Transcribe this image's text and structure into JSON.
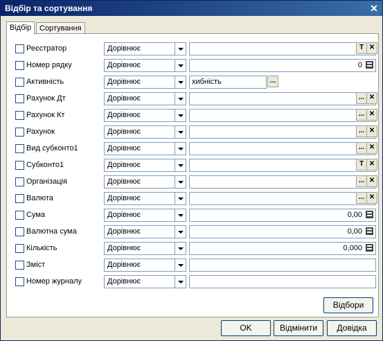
{
  "window": {
    "title": "Відбір та сортування"
  },
  "tabs": [
    {
      "label": "Відбір"
    },
    {
      "label": "Сортування"
    }
  ],
  "rows": [
    {
      "label": "Реєстратор",
      "condition": "Дорівнює",
      "value": "",
      "kind": "typeclear"
    },
    {
      "label": "Номер рядку",
      "condition": "Дорівнює",
      "value": "0",
      "kind": "calc"
    },
    {
      "label": "Активність",
      "condition": "Дорівнює",
      "value": "хибність",
      "kind": "bool"
    },
    {
      "label": "Рахунок Дт",
      "condition": "Дорівнює",
      "value": "",
      "kind": "pick"
    },
    {
      "label": "Рахунок Кт",
      "condition": "Дорівнює",
      "value": "",
      "kind": "pick"
    },
    {
      "label": "Рахунок",
      "condition": "Дорівнює",
      "value": "",
      "kind": "pick"
    },
    {
      "label": "Вид субконто1",
      "condition": "Дорівнює",
      "value": "",
      "kind": "pick"
    },
    {
      "label": "Субконто1",
      "condition": "Дорівнює",
      "value": "",
      "kind": "typeclear"
    },
    {
      "label": "Організація",
      "condition": "Дорівнює",
      "value": "",
      "kind": "pick"
    },
    {
      "label": "Валюта",
      "condition": "Дорівнює",
      "value": "",
      "kind": "pick"
    },
    {
      "label": "Сума",
      "condition": "Дорівнює",
      "value": "0,00",
      "kind": "calc"
    },
    {
      "label": "Валютна сума",
      "condition": "Дорівнює",
      "value": "0,00",
      "kind": "calc"
    },
    {
      "label": "Кількість",
      "condition": "Дорівнює",
      "value": "0,000",
      "kind": "calc"
    },
    {
      "label": "Зміст",
      "condition": "Дорівнює",
      "value": "",
      "kind": "text"
    },
    {
      "label": "Номер журналу",
      "condition": "Дорівнює",
      "value": "",
      "kind": "text"
    }
  ],
  "glyphs": {
    "type": "T",
    "clear": "✕",
    "pick": "..."
  },
  "buttons": {
    "filters": "Відбори",
    "ok": "OK",
    "cancel": "Відмінити",
    "help": "Довідка"
  }
}
